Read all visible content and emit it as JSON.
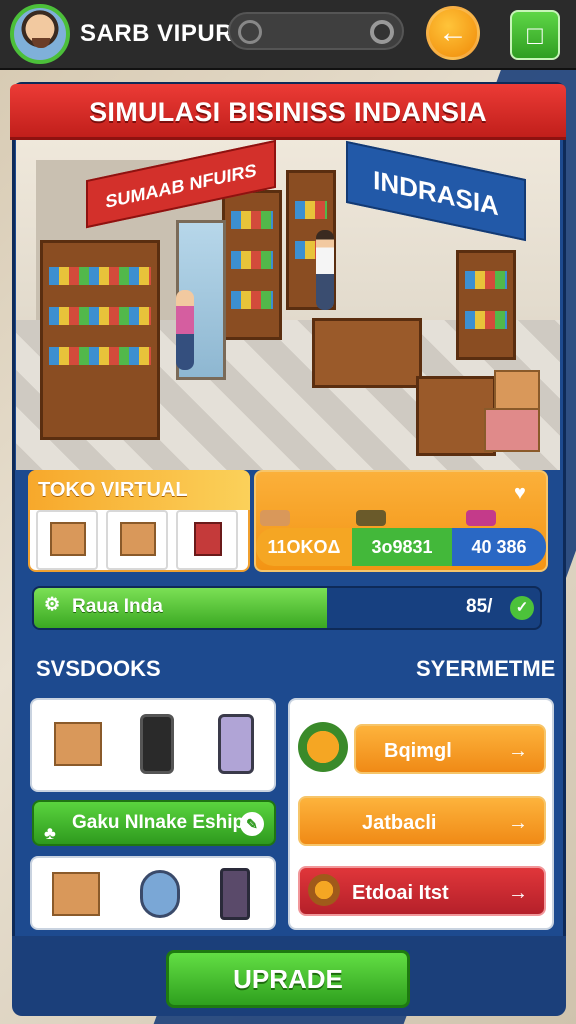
{
  "header": {
    "player_name": "SARB VIPURS",
    "avatar_icon": "player-avatar",
    "back_icon": "back-arrow-icon",
    "menu_icon": "menu-icon"
  },
  "banner": {
    "title": "SIMULASI BISINISS INDANSIA"
  },
  "scene": {
    "sign_left": "SUMAAB NFUIRS",
    "sign_right": "INDRASIA"
  },
  "toko": {
    "title": "TOKO VIRTUAL",
    "stats": [
      "11OKOΔ",
      "3o9831",
      "40 386"
    ]
  },
  "progress": {
    "label": "Raua Inda",
    "value": "85/",
    "percent": 0.58
  },
  "sections": {
    "left_title": "SVSDOOKS",
    "right_title": "SYERMETME"
  },
  "actions": {
    "green_button": "Gaku NInake Eship",
    "items": [
      {
        "label": "Bqimgl",
        "arrow": "→"
      },
      {
        "label": "Jatbacli",
        "arrow": "→"
      },
      {
        "label": "Etdoai Itst",
        "arrow": "→"
      }
    ]
  },
  "footer": {
    "upgrade_label": "UPRADE"
  },
  "colors": {
    "accent_orange": "#f39414",
    "accent_green": "#43b83a",
    "accent_blue": "#2a68c4",
    "accent_red": "#d3302b",
    "panel_blue": "#1d4a8f"
  }
}
